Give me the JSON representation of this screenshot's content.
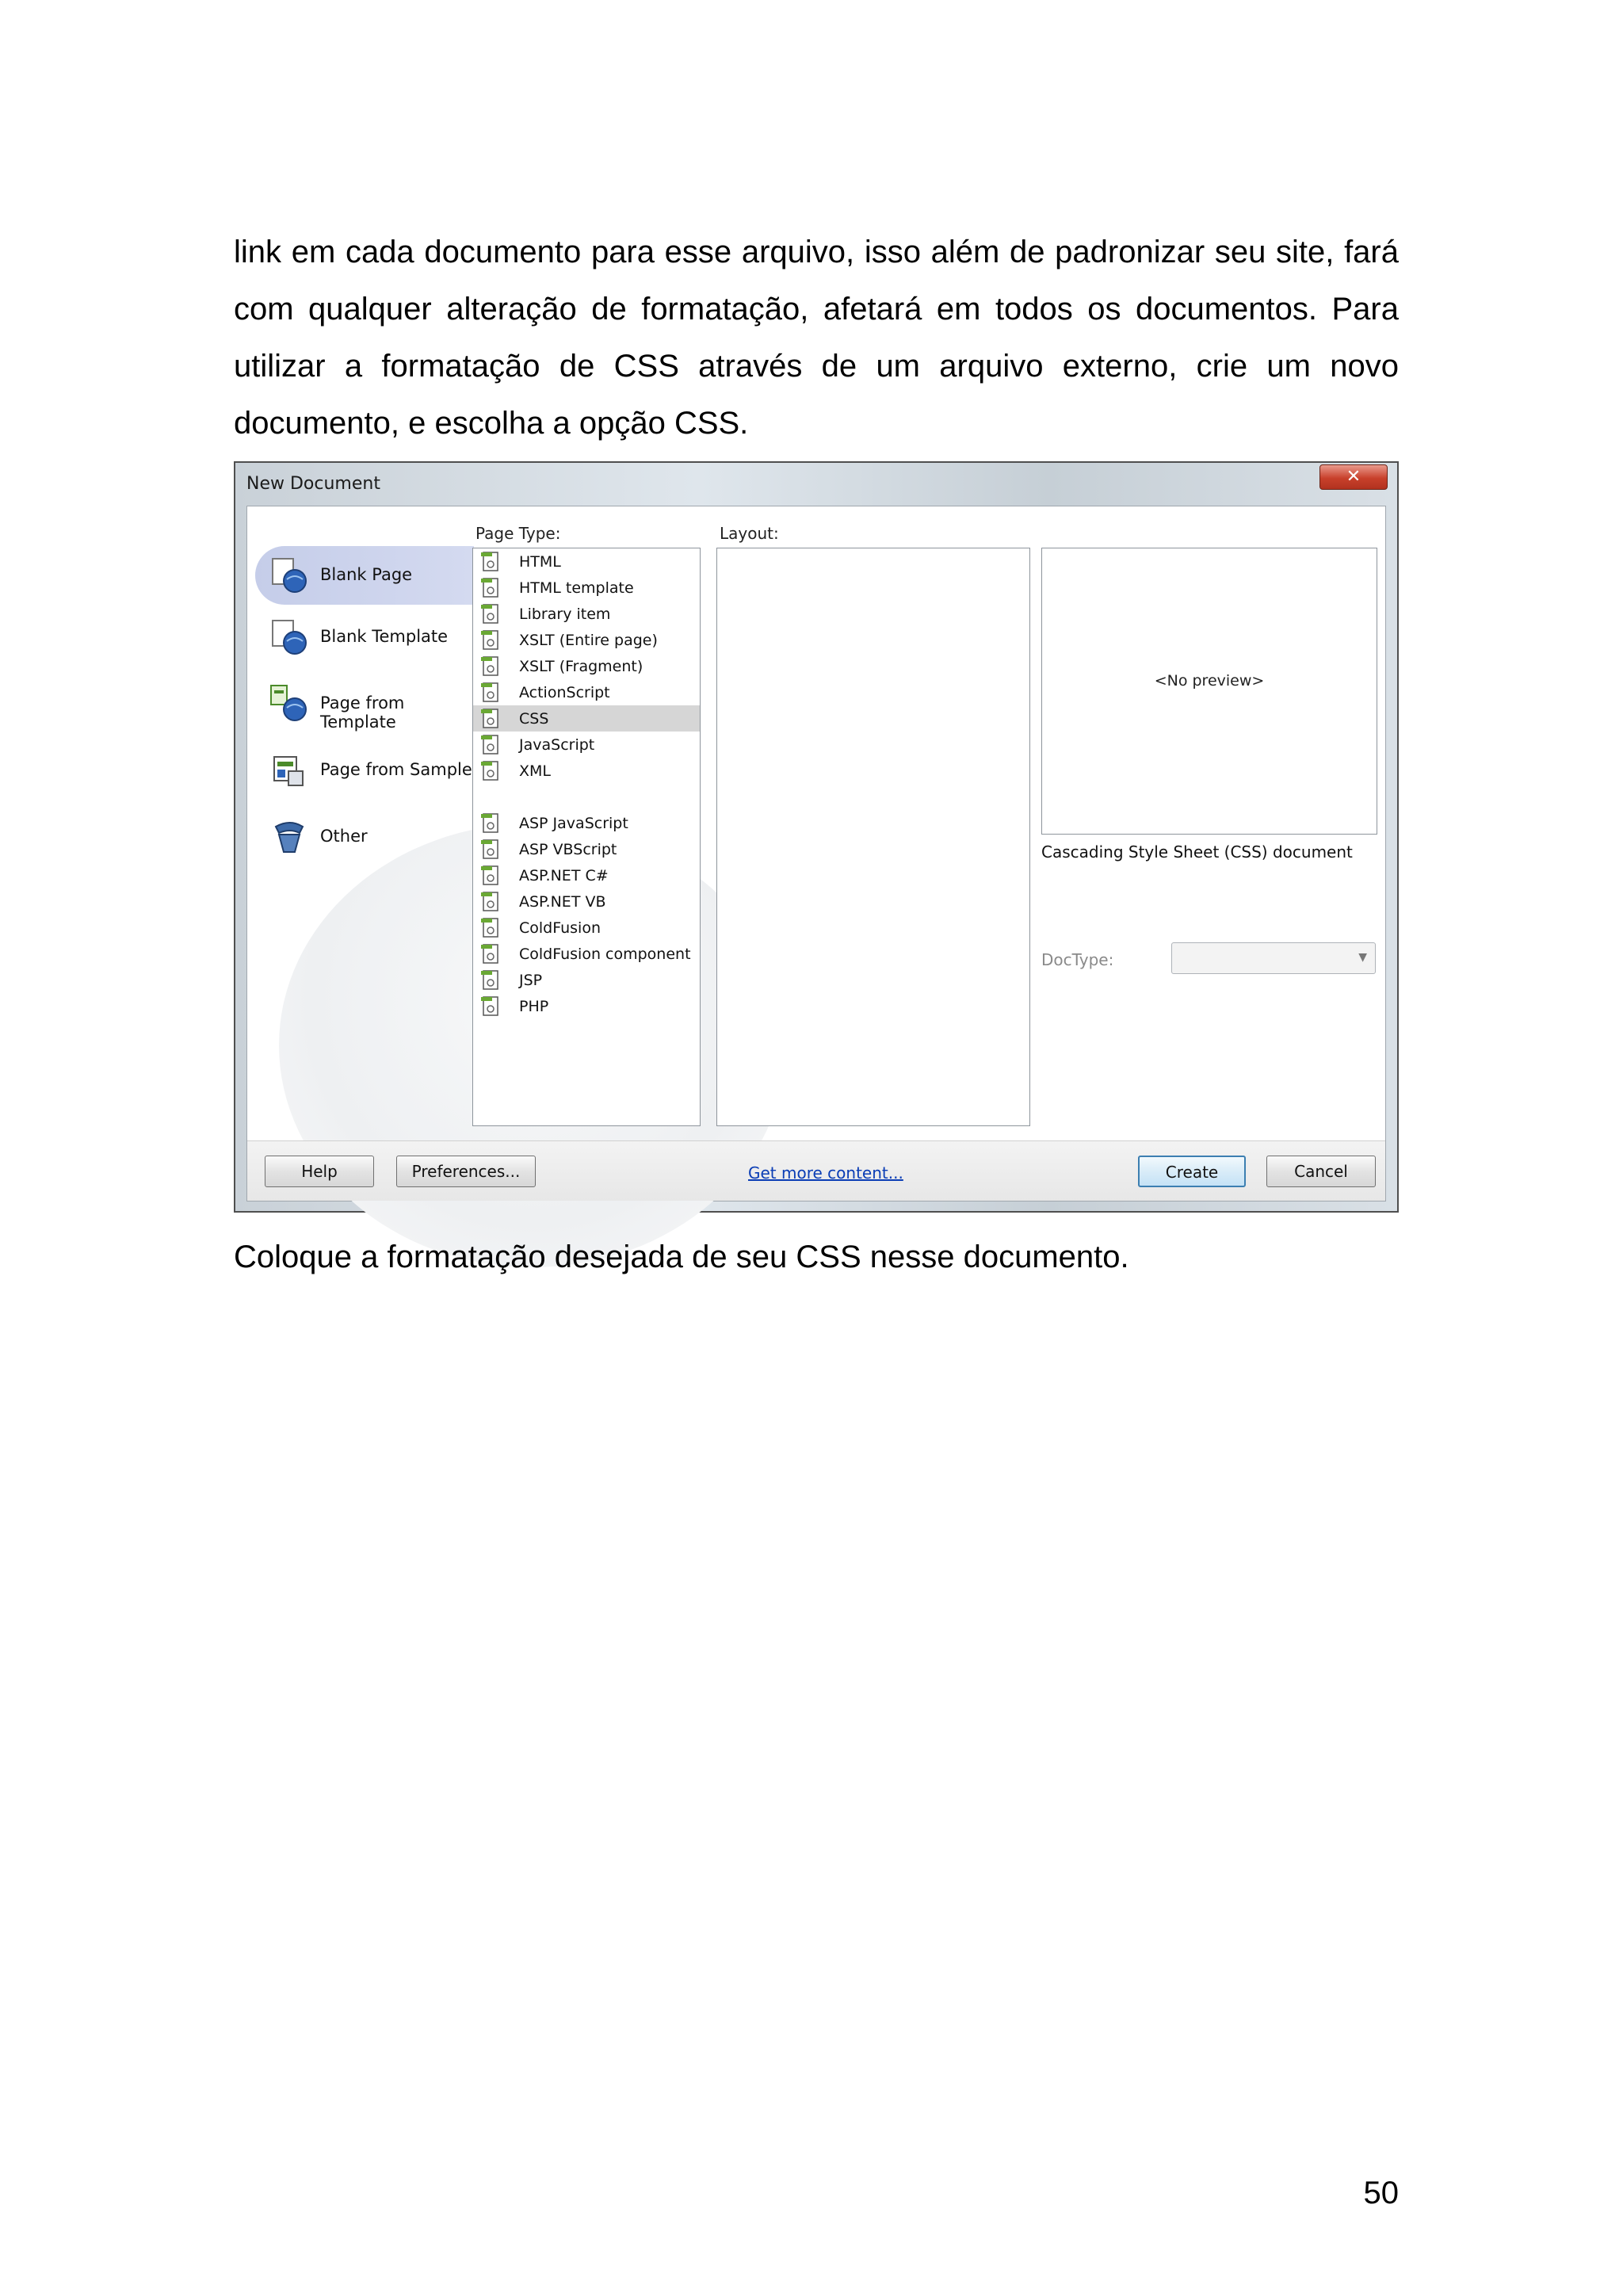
{
  "paragraphs": {
    "intro": "link em cada documento para esse arquivo, isso além de padronizar seu site, fará com qualquer alteração de formatação, afetará em todos os documentos. Para utilizar a formatação de CSS através de um arquivo externo, crie um novo documento, e escolha a opção CSS.",
    "after": "Coloque a formatação desejada de seu CSS nesse documento."
  },
  "page_number": "50",
  "dialog": {
    "title": "New Document",
    "close_glyph": "✕",
    "categories": [
      {
        "label": "Blank Page",
        "icon": "blank-page-icon",
        "selected": true
      },
      {
        "label": "Blank Template",
        "icon": "blank-template-icon",
        "selected": false
      },
      {
        "label": "Page from Template",
        "icon": "page-from-template-icon",
        "selected": false
      },
      {
        "label": "Page from Sample",
        "icon": "page-from-sample-icon",
        "selected": false
      },
      {
        "label": "Other",
        "icon": "other-icon",
        "selected": false
      }
    ],
    "page_type_label": "Page Type:",
    "page_types": [
      {
        "label": "HTML"
      },
      {
        "label": "HTML template"
      },
      {
        "label": "Library item"
      },
      {
        "label": "XSLT (Entire page)"
      },
      {
        "label": "XSLT (Fragment)"
      },
      {
        "label": "ActionScript"
      },
      {
        "label": "CSS",
        "selected": true
      },
      {
        "label": "JavaScript"
      },
      {
        "label": "XML"
      },
      {
        "label": "ASP JavaScript"
      },
      {
        "label": "ASP VBScript"
      },
      {
        "label": "ASP.NET C#"
      },
      {
        "label": "ASP.NET VB"
      },
      {
        "label": "ColdFusion"
      },
      {
        "label": "ColdFusion component"
      },
      {
        "label": "JSP"
      },
      {
        "label": "PHP"
      }
    ],
    "layout_label": "Layout:",
    "preview_text": "<No preview>",
    "description": "Cascading Style Sheet (CSS) document",
    "doctype_label": "DocType:",
    "doctype_value": "",
    "buttons": {
      "help": "Help",
      "preferences": "Preferences...",
      "get_more": "Get more content...",
      "create": "Create",
      "cancel": "Cancel"
    },
    "colors": {
      "selected_category": "#c5cde9",
      "selected_type": "#d6d6d6",
      "link": "#0a3db5",
      "close_button": "#c8402b"
    }
  }
}
